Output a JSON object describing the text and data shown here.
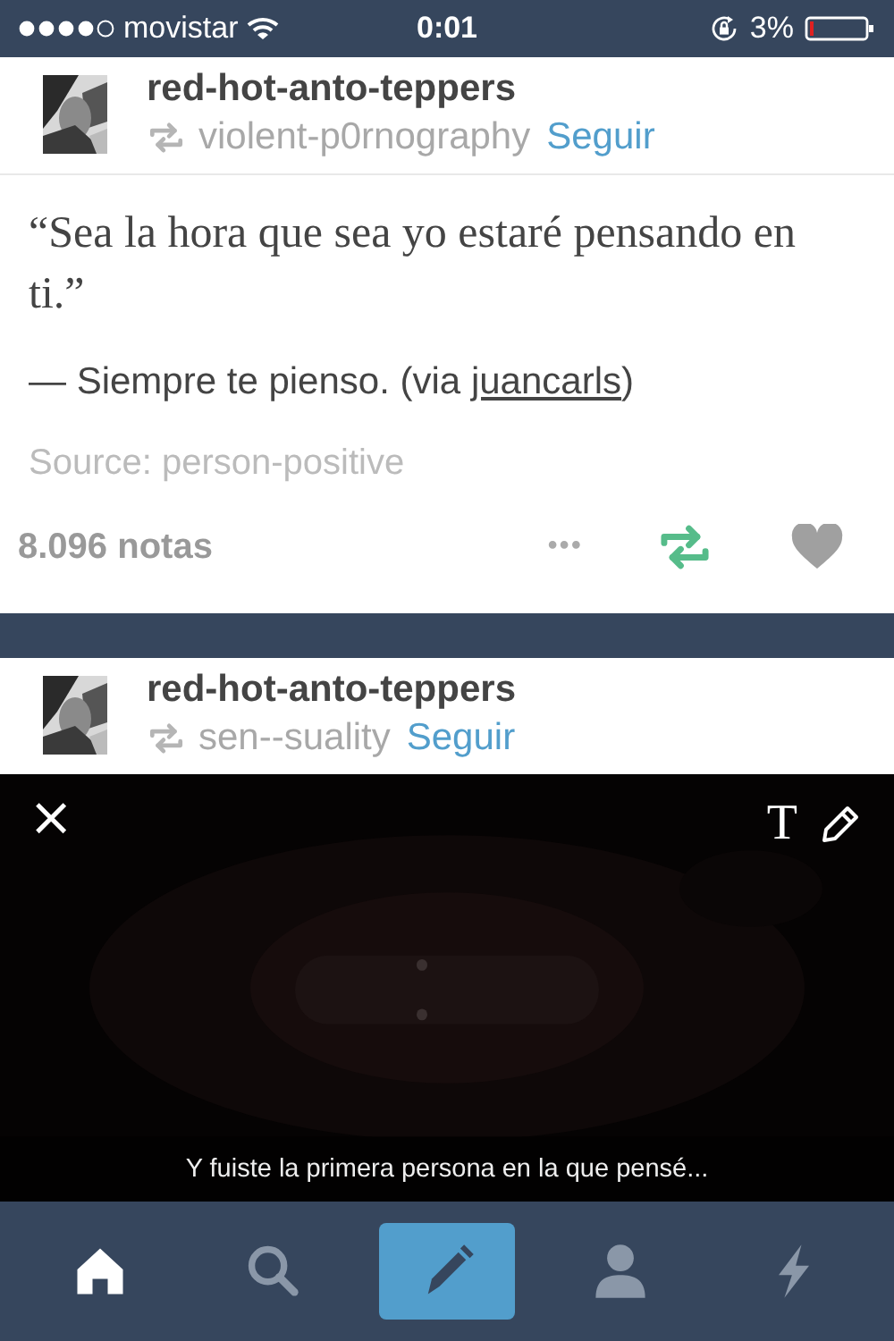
{
  "status_bar": {
    "carrier": "movistar",
    "time": "0:01",
    "battery": "3%"
  },
  "posts": [
    {
      "kind": "quote",
      "blog_name": "red-hot-anto-teppers",
      "reblogged_from": "violent-p0rnography",
      "follow": "Seguir",
      "quote": "“Sea la hora que sea yo estaré pensando en ti.”",
      "attribution": "— Siempre te pienso. (via ",
      "via_link": "juancarls",
      "attribution_end": ")",
      "source": "Source: person-positive",
      "notes": "8.096 notas",
      "more": "•••",
      "reblogged": true,
      "liked": false
    },
    {
      "blog_name": "red-hot-anto-teppers",
      "reblogged_from": "sen--suality",
      "follow": "Seguir",
      "close": "×",
      "text_tool": "T",
      "caption": "Y fuiste la primera persona en la que pensé..."
    }
  ],
  "tabs": [
    {
      "kind": "home",
      "selected": true
    },
    {
      "kind": "search",
      "selected": false
    },
    {
      "kind": "compose",
      "selected": false
    },
    {
      "kind": "account",
      "selected": false
    },
    {
      "kind": "activity",
      "selected": false
    }
  ]
}
